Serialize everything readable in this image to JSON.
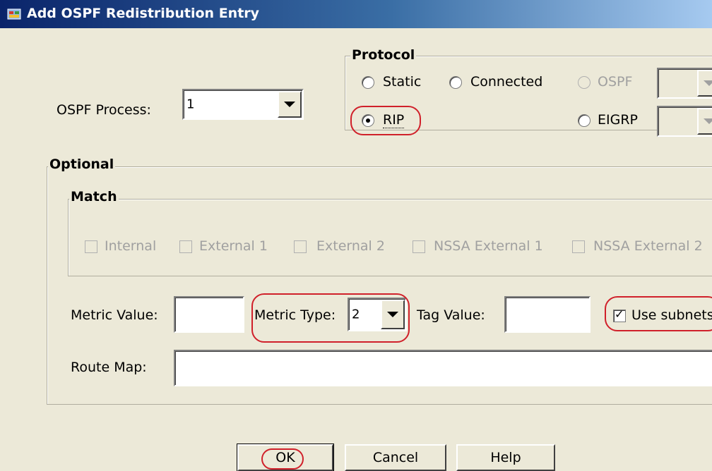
{
  "window": {
    "title": "Add OSPF Redistribution Entry",
    "icon": "asdm-app-icon"
  },
  "ospf_process": {
    "label": "OSPF Process:",
    "value": "1"
  },
  "protocol": {
    "legend": "Protocol",
    "options": {
      "static": "Static",
      "connected": "Connected",
      "ospf": "OSPF",
      "rip": "RIP",
      "eigrp": "EIGRP"
    },
    "selected": "RIP"
  },
  "optional": {
    "legend": "Optional",
    "match": {
      "legend": "Match",
      "items": [
        "Internal",
        "External 1",
        "External 2",
        "NSSA External 1",
        "NSSA External 2"
      ]
    },
    "metric_value": {
      "label": "Metric Value:",
      "value": ""
    },
    "metric_type": {
      "label": "Metric Type:",
      "value": "2"
    },
    "tag_value": {
      "label": "Tag Value:",
      "value": ""
    },
    "use_subnets": {
      "label": "Use subnets",
      "checked": true
    },
    "route_map": {
      "label": "Route Map:",
      "value": ""
    }
  },
  "buttons": {
    "ok": "OK",
    "cancel": "Cancel",
    "help": "Help"
  },
  "colors": {
    "highlight": "#d0202a",
    "title_gradient_start": "#0a246a",
    "dialog_bg": "#ece9d8"
  }
}
